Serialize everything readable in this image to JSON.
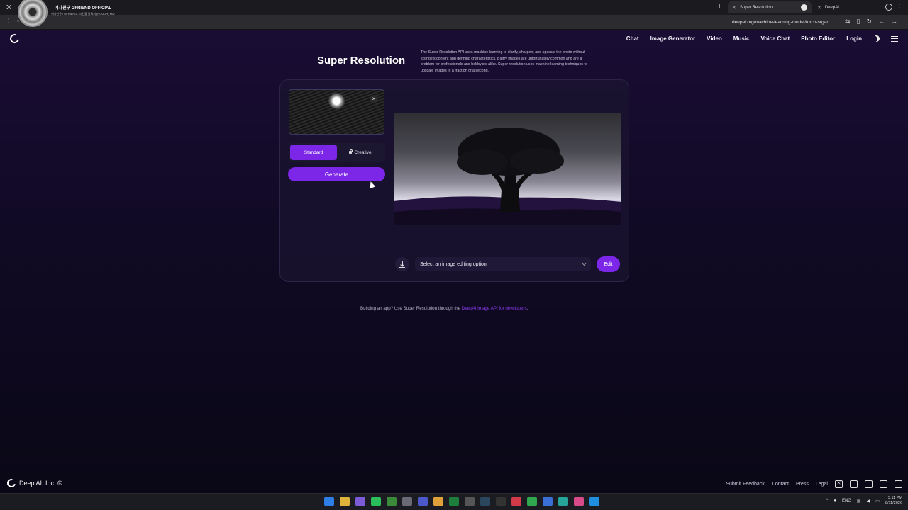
{
  "browser": {
    "media": {
      "title": "여자친구 GFRIEND OFFICIAL",
      "subtitle": "여자친구 / GFRIEND - 시간을 달려서 (ROUGH) M/V"
    },
    "tabs": [
      {
        "label": "Super Resolution"
      },
      {
        "label": "DeepAI"
      }
    ],
    "url": "deepai.org/machine-learning-model/torch-srgan"
  },
  "nav": {
    "items": [
      "Chat",
      "Image Generator",
      "Video",
      "Music",
      "Voice Chat",
      "Photo Editor",
      "Login"
    ]
  },
  "page": {
    "title": "Super Resolution",
    "description": "The Super Resolution API uses machine learning to clarify, sharpen, and upscale the photo without losing its content and defining characteristics. Blurry images are unfortunately common and are a problem for professionals and hobbyists alike. Super resolution uses machine learning techniques to upscale images in a fraction of a second."
  },
  "tool": {
    "close_glyph": "×",
    "modes": {
      "standard": "Standard",
      "creative": "Creative"
    },
    "generate_label": "Generate",
    "edit_select_placeholder": "Select an image editing option",
    "edit_label": "Edit"
  },
  "developer_note": {
    "prefix": "Building an app? Use Super Resolution through the ",
    "link": "DeepAI Image API for developers",
    "suffix": "."
  },
  "footer": {
    "brand": "Deep AI, Inc. ©",
    "links": [
      "Submit Feedback",
      "Contact",
      "Press",
      "Legal"
    ]
  },
  "taskbar": {
    "language": "ENG",
    "time": "3:11 PM",
    "date": "8/11/2026"
  },
  "colors": {
    "accent": "#7c26e8",
    "background": "#0b0817"
  }
}
